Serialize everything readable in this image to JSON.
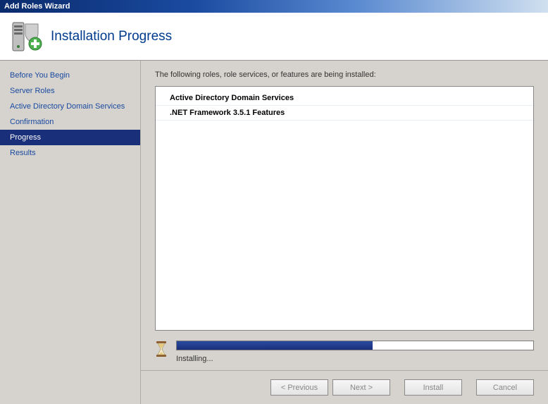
{
  "window": {
    "title": "Add Roles Wizard"
  },
  "header": {
    "title": "Installation Progress"
  },
  "sidebar": {
    "items": [
      {
        "label": "Before You Begin",
        "selected": false
      },
      {
        "label": "Server Roles",
        "selected": false
      },
      {
        "label": "Active Directory Domain Services",
        "selected": false
      },
      {
        "label": "Confirmation",
        "selected": false
      },
      {
        "label": "Progress",
        "selected": true
      },
      {
        "label": "Results",
        "selected": false
      }
    ]
  },
  "main": {
    "intro": "The following roles, role services, or features are being installed:",
    "items": [
      "Active Directory Domain Services",
      ".NET Framework 3.5.1 Features"
    ],
    "progress": {
      "percent": 55,
      "status": "Installing..."
    }
  },
  "footer": {
    "previous": "< Previous",
    "next": "Next >",
    "install": "Install",
    "cancel": "Cancel"
  }
}
